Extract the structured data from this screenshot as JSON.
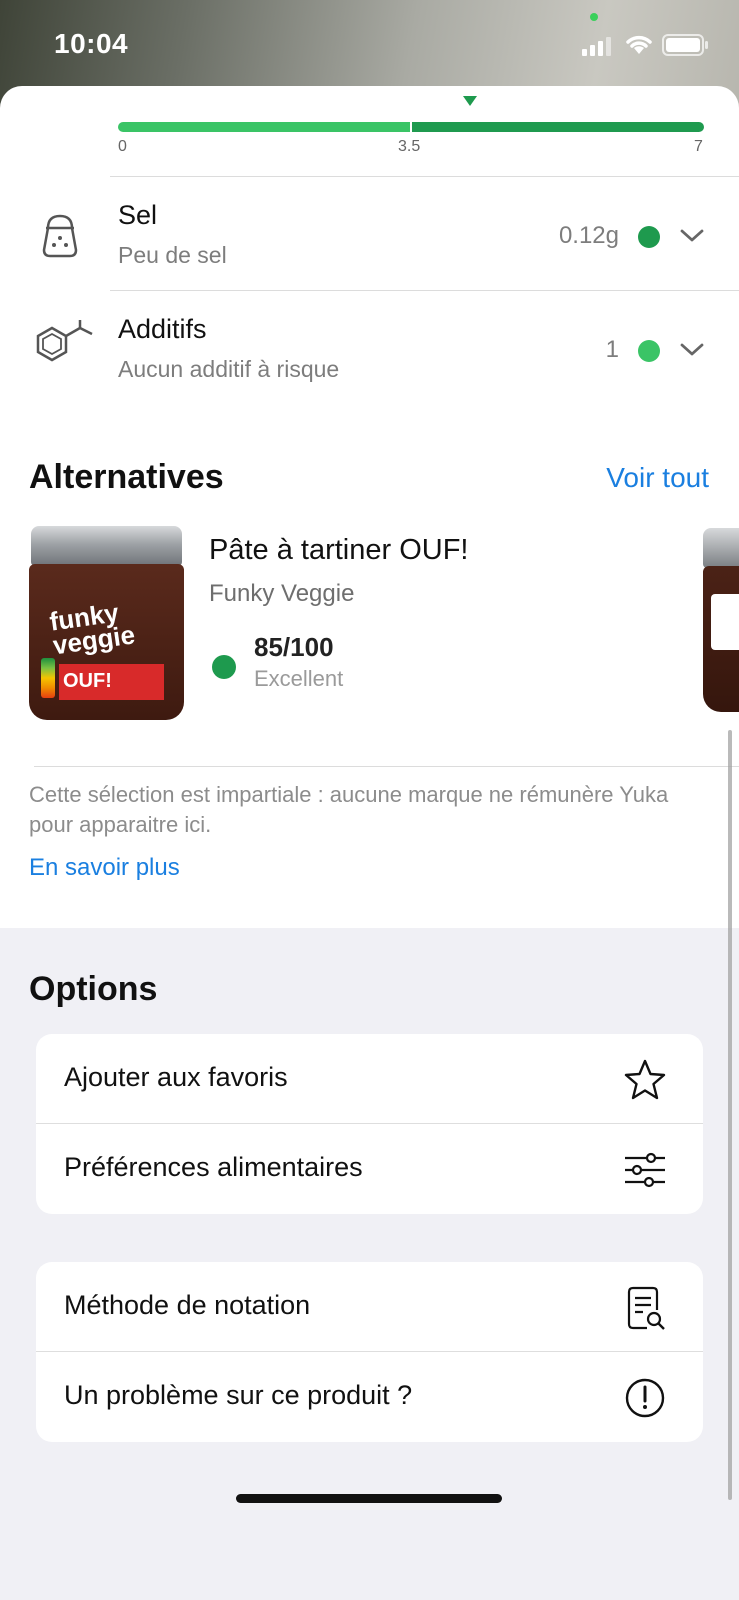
{
  "status_bar": {
    "time": "10:04"
  },
  "scale": {
    "min": "0",
    "mid": "3.5",
    "max": "7",
    "marker_value": 4.0
  },
  "nutrients": [
    {
      "title": "Sel",
      "subtitle": "Peu de sel",
      "value": "0.12g",
      "dot_color": "#1e9a4e",
      "icon": "salt-shaker-icon"
    },
    {
      "title": "Additifs",
      "subtitle": "Aucun additif à risque",
      "value": "1",
      "dot_color": "#3ac466",
      "icon": "molecule-icon"
    }
  ],
  "alternatives": {
    "title": "Alternatives",
    "see_all": "Voir tout",
    "item": {
      "name": "Pâte à tartiner OUF!",
      "brand": "Funky Veggie",
      "score": "85/100",
      "score_label": "Excellent",
      "score_color": "#1e9a4e",
      "jar_brand_line1": "funky",
      "jar_brand_line2": "veggie",
      "jar_product": "OUF!"
    },
    "disclaimer": "Cette sélection est impartiale : aucune marque ne rémunère Yuka pour apparaitre ici.",
    "learn_more": "En savoir plus"
  },
  "options": {
    "title": "Options",
    "group1": [
      {
        "label": "Ajouter aux favoris",
        "icon": "star-icon"
      },
      {
        "label": "Préférences alimentaires",
        "icon": "sliders-icon"
      }
    ],
    "group2": [
      {
        "label": "Méthode de notation",
        "icon": "document-search-icon"
      },
      {
        "label": "Un problème sur ce produit ?",
        "icon": "exclamation-circle-icon"
      }
    ]
  }
}
